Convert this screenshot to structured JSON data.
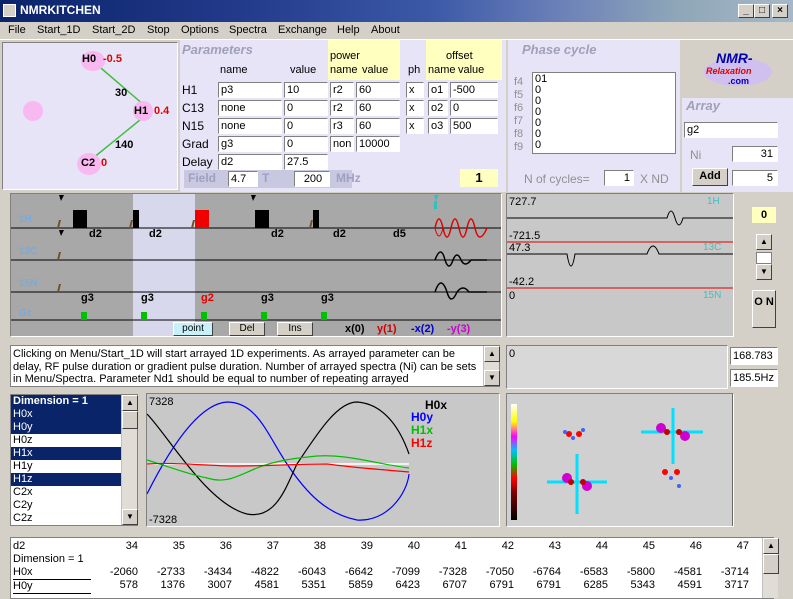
{
  "window": {
    "title": "NMRKITCHEN"
  },
  "menu": [
    "File",
    "Start_1D",
    "Start_2D",
    "Stop",
    "Options",
    "Spectra",
    "Exchange",
    "Help",
    "About"
  ],
  "spins": {
    "h0": {
      "label": "H0",
      "value": "-0.5"
    },
    "h1": {
      "label": "H1",
      "value": "0.4"
    },
    "c2": {
      "label": "C2",
      "value": "0"
    },
    "j1": "30",
    "j2": "140"
  },
  "parameters": {
    "title": "Parameters",
    "col_name": "name",
    "col_value": "value",
    "power_hdr": "power",
    "power_name": "name",
    "power_value": "value",
    "ph": "ph",
    "offset_hdr": "offset",
    "offset_name": "name",
    "offset_value": "value",
    "rows": [
      {
        "label": "H1",
        "name": "p3",
        "value": "10",
        "pname": "r2",
        "pvalue": "60",
        "ph": "x",
        "oname": "o1",
        "ovalue": "-500"
      },
      {
        "label": "C13",
        "name": "none",
        "value": "0",
        "pname": "r2",
        "pvalue": "60",
        "ph": "x",
        "oname": "o2",
        "ovalue": "0"
      },
      {
        "label": "N15",
        "name": "none",
        "value": "0",
        "pname": "r3",
        "pvalue": "60",
        "ph": "x",
        "oname": "o3",
        "ovalue": "500"
      },
      {
        "label": "Grad",
        "name": "g3",
        "value": "0",
        "pname": "non",
        "pvalue": "10000"
      },
      {
        "label": "Delay",
        "name": "d2",
        "value": "27.5"
      }
    ],
    "field_label": "Field",
    "field_value": "4.7",
    "t_label": "T",
    "t_value": "200",
    "mhz_label": "MHz",
    "counter": "1"
  },
  "phase_cycle": {
    "title": "Phase cycle",
    "labels": [
      "f4",
      "f5",
      "f6",
      "f7",
      "f8",
      "f9"
    ],
    "values": [
      "01",
      "0",
      "0",
      "0",
      "0",
      "0",
      "0"
    ],
    "ncycles_label": "N of cycles=",
    "ncycles_value": "1",
    "nd_label": "X ND"
  },
  "logo": {
    "line1": "NMR-",
    "line2": "Relaxation",
    "line3": ".com"
  },
  "array": {
    "title": "Array",
    "param": "g2",
    "ni_label": "Ni",
    "ni_value": "31",
    "add_label": "Add",
    "add_value": "5"
  },
  "sequence": {
    "channels": [
      "1H",
      "13C",
      "15N",
      "Gz"
    ],
    "delays_h": [
      "d2",
      "d2",
      "d2",
      "d2",
      "d5"
    ],
    "grads": [
      "g3",
      "g3",
      "g2",
      "g3",
      "g3"
    ],
    "btn_point": "point",
    "btn_del": "Del",
    "btn_ins": "Ins",
    "phases": [
      {
        "text": "x(0)",
        "color": "#000000"
      },
      {
        "text": "y(1)",
        "color": "#d00000"
      },
      {
        "text": "-x(2)",
        "color": "#0000d0"
      },
      {
        "text": "-y(3)",
        "color": "#d000d0"
      }
    ]
  },
  "spectra_top": {
    "v1": "727.7",
    "v2": "-721.5",
    "v3": "47.3",
    "v4": "-42.2",
    "v5": "0",
    "lbl1": "1H",
    "lbl2": "13C",
    "lbl3": "15N"
  },
  "right_ctrl": {
    "value": "0",
    "on_label": "O N"
  },
  "info_text": "Clicking on Menu/Start_1D will start arrayed 1D experiments. As arrayed parameter can be delay, RF pulse duration or gradient pulse duration. Number of arrayed spectra (Ni) can be sets in Menu/Spectra. Parameter Nd1 should be equal to number of repeating arrayed",
  "mid_right": {
    "v0": "0",
    "f1": "168.783",
    "f2": "185.5Hz"
  },
  "dimension_list": {
    "items": [
      "Dimension = 1",
      "H0x",
      "H0y",
      "H0z",
      "H1x",
      "H1y",
      "H1z",
      "C2x",
      "C2y",
      "C2z"
    ],
    "selected": [
      0,
      1,
      2,
      4,
      6
    ]
  },
  "plot": {
    "ymax": "7328",
    "ymin": "-7328",
    "legend": [
      {
        "name": "H0x",
        "color": "#000000"
      },
      {
        "name": "H0y",
        "color": "#0000ff"
      },
      {
        "name": "H1x",
        "color": "#00c000"
      },
      {
        "name": "H1z",
        "color": "#ff0000"
      }
    ]
  },
  "table": {
    "row_labels": [
      "d2",
      "Dimension = 1",
      "H0x",
      "H0y"
    ],
    "columns": [
      "34",
      "35",
      "36",
      "37",
      "38",
      "39",
      "40",
      "41",
      "42",
      "43",
      "44",
      "45",
      "46",
      "47"
    ],
    "h0x": [
      "-2060",
      "-2733",
      "-3434",
      "-4822",
      "-6043",
      "-6642",
      "-7099",
      "-7328",
      "-7050",
      "-6764",
      "-6583",
      "-5800",
      "-4581",
      "-3714"
    ],
    "h0y": [
      "578",
      "1376",
      "3007",
      "4581",
      "5351",
      "5859",
      "6423",
      "6707",
      "6791",
      "6791",
      "6285",
      "5343",
      "4591",
      "3717"
    ]
  }
}
